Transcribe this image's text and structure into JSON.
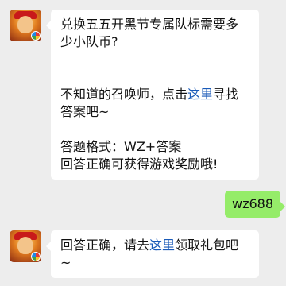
{
  "messages": [
    {
      "question_line1": "兑换五五开黑节专属队标需要多",
      "question_line2": "少小队币?",
      "hint_prefix": "不知道的召唤师，点击",
      "hint_link": "这里",
      "hint_suffix": "寻找",
      "hint_line2": "答案吧~",
      "format_line": "答题格式：WZ+答案",
      "reward_line": "回答正确可获得游戏奖励哦!"
    },
    {
      "reply": "wz688"
    },
    {
      "answer_prefix": "回答正确，请去",
      "answer_link": "这里",
      "answer_suffix": "领取礼包吧",
      "answer_line2": "~"
    }
  ],
  "colors": {
    "background": "#ededed",
    "incoming_bubble": "#ffffff",
    "outgoing_bubble": "#95ec69",
    "link": "#1a5ab8"
  },
  "icons": [
    "bot-avatar-icon",
    "game-badge-icon"
  ]
}
